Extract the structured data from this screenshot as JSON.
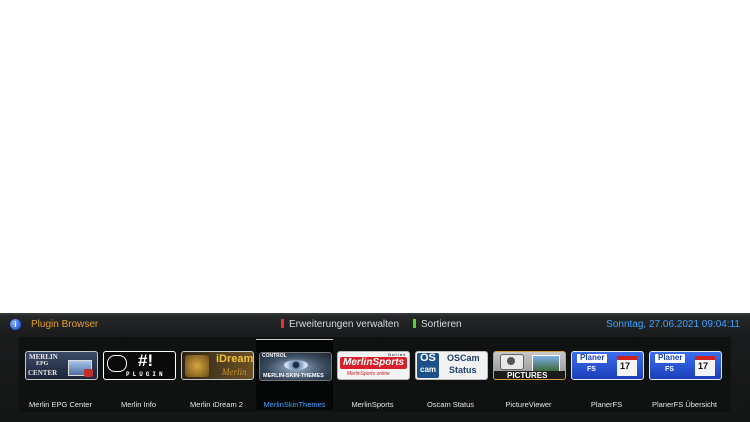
{
  "header": {
    "title": "Plugin Browser",
    "red_key": "Erweiterungen verwalten",
    "green_key": "Sortieren",
    "datetime": "Sonntag, 27.06.2021  09:04:11"
  },
  "colors": {
    "title": "#e6a020",
    "datetime": "#3ba3ff",
    "red": "#e8303a",
    "green": "#56d23a",
    "selected_label": "#3ba3ff"
  },
  "plugins": [
    {
      "label": "Merlin EPG Center",
      "logo": [
        "MERLIN",
        "EPG",
        "CENTER"
      ]
    },
    {
      "label": "Merlin Info",
      "logo": [
        "#!",
        "PLUGIN"
      ]
    },
    {
      "label": "Merlin iDream 2",
      "logo": [
        "iDream",
        "Merlin"
      ]
    },
    {
      "label": "MerlinSkinThemes",
      "logo": [
        "CONTROL",
        "MERLIN-SKIN-THEMES"
      ],
      "selected": true
    },
    {
      "label": "MerlinSports",
      "logo": [
        "MerlinSports",
        "MerlinSports online",
        "Online"
      ]
    },
    {
      "label": "Oscam Status",
      "logo": [
        "OS",
        "cam",
        "OSCam",
        "Status"
      ]
    },
    {
      "label": "PictureViewer",
      "logo": [
        "PICTURES"
      ]
    },
    {
      "label": "PlanerFS",
      "logo": [
        "Planer",
        "FS",
        "17"
      ]
    },
    {
      "label": "PlanerFS Übersicht",
      "logo": [
        "Planer",
        "FS",
        "17"
      ]
    }
  ]
}
